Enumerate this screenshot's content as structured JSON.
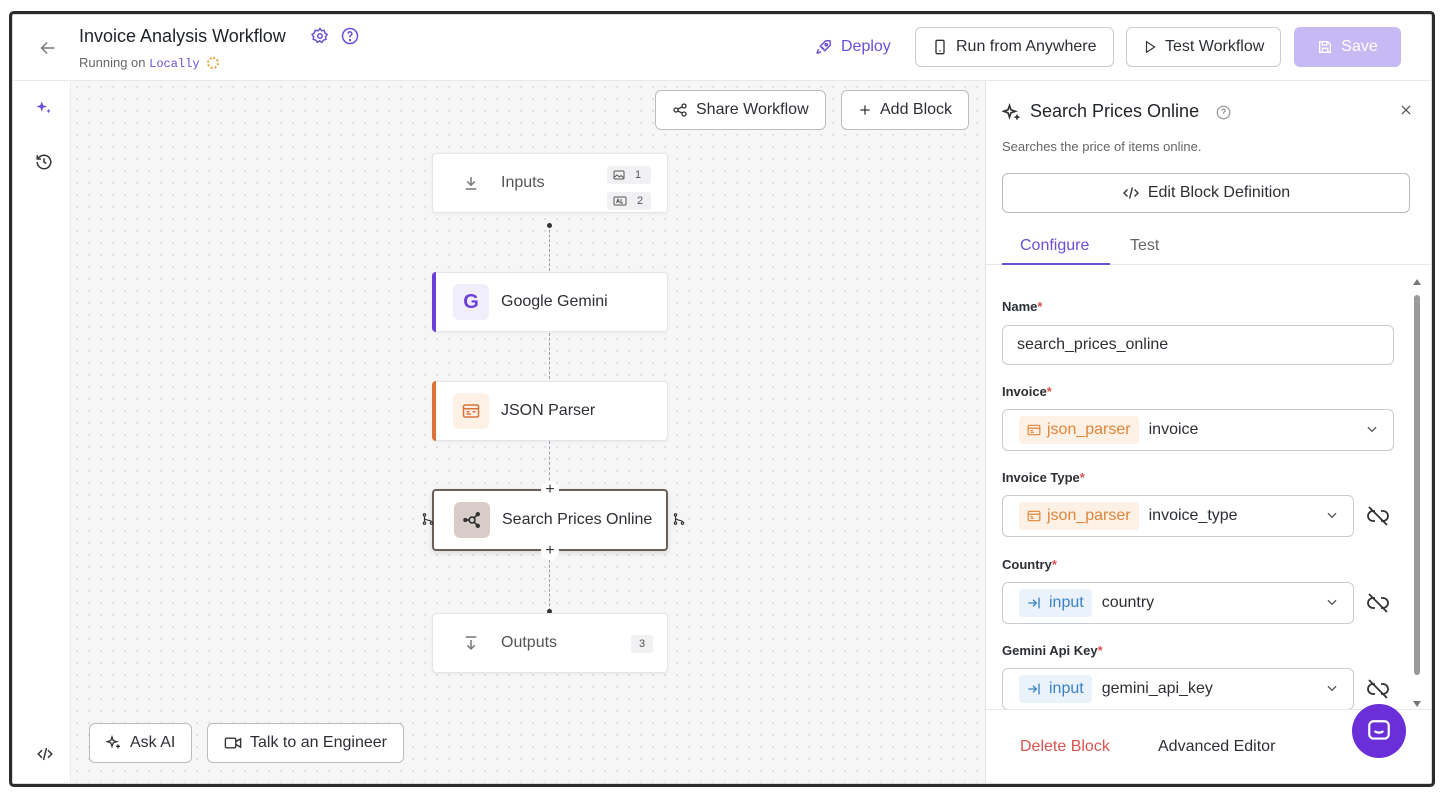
{
  "header": {
    "title": "Invoice Analysis Workflow",
    "running_prefix": "Running on",
    "running_target": "Locally",
    "deploy_label": "Deploy",
    "run_anywhere_label": "Run from Anywhere",
    "test_workflow_label": "Test Workflow",
    "save_label": "Save"
  },
  "canvas": {
    "share_label": "Share Workflow",
    "add_block_label": "Add Block",
    "ask_ai_label": "Ask AI",
    "talk_engineer_label": "Talk to an Engineer",
    "nodes": {
      "inputs": {
        "label": "Inputs",
        "image_count": "1",
        "text_count": "2"
      },
      "gemini": {
        "label": "Google Gemini",
        "icon_letter": "G"
      },
      "json_parser": {
        "label": "JSON Parser"
      },
      "search": {
        "label": "Search Prices Online"
      },
      "outputs": {
        "label": "Outputs",
        "count": "3"
      }
    }
  },
  "panel": {
    "title": "Search Prices Online",
    "description": "Searches the price of items online.",
    "edit_definition_label": "Edit Block Definition",
    "tabs": [
      "Configure",
      "Test"
    ],
    "fields": {
      "name": {
        "label": "Name",
        "value": "search_prices_online"
      },
      "invoice": {
        "label": "Invoice",
        "source": "json_parser",
        "value": "invoice"
      },
      "invoice_type": {
        "label": "Invoice Type",
        "source": "json_parser",
        "value": "invoice_type"
      },
      "country": {
        "label": "Country",
        "source": "input",
        "value": "country"
      },
      "gemini_api_key": {
        "label": "Gemini Api Key",
        "source": "input",
        "value": "gemini_api_key"
      }
    },
    "required_mark": "*",
    "delete_label": "Delete Block",
    "advanced_label": "Advanced Editor"
  },
  "colors": {
    "accent": "#6b4fd8",
    "gemini_bar": "#6b3fd8",
    "json_bar": "#d9733a",
    "danger": "#d9534f"
  }
}
